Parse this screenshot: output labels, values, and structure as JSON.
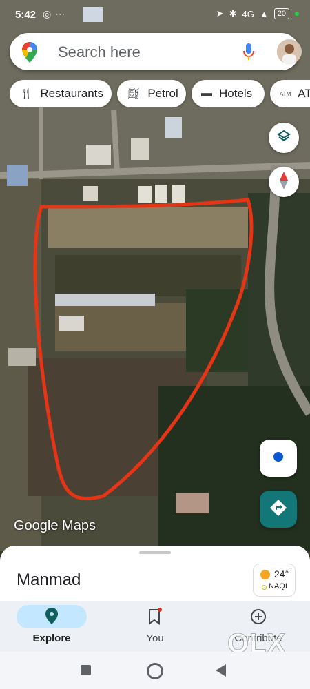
{
  "status_bar": {
    "time": "5:42",
    "battery": "20",
    "network": "4G"
  },
  "search": {
    "placeholder": "Search here"
  },
  "chips": [
    {
      "label": "Restaurants",
      "icon": "restaurant-icon"
    },
    {
      "label": "Petrol",
      "icon": "gas-station-icon"
    },
    {
      "label": "Hotels",
      "icon": "bed-icon"
    },
    {
      "label": "AT",
      "icon": "atm-icon",
      "icon_text": "ATM"
    }
  ],
  "map": {
    "watermark": "Google Maps"
  },
  "sheet": {
    "place": "Manmad",
    "temperature": "24°",
    "aqi": "NAQI"
  },
  "bottom_nav": [
    {
      "label": "Explore",
      "icon": "explore-pin-icon",
      "active": true
    },
    {
      "label": "You",
      "icon": "bookmark-icon"
    },
    {
      "label": "Contribute",
      "icon": "add-circle-icon"
    }
  ],
  "colors": {
    "accent": "#0b57d0",
    "directions": "#127776",
    "explore_pill": "#c2e7ff",
    "highlight": "#e53517"
  },
  "watermark_brand": "OLX"
}
